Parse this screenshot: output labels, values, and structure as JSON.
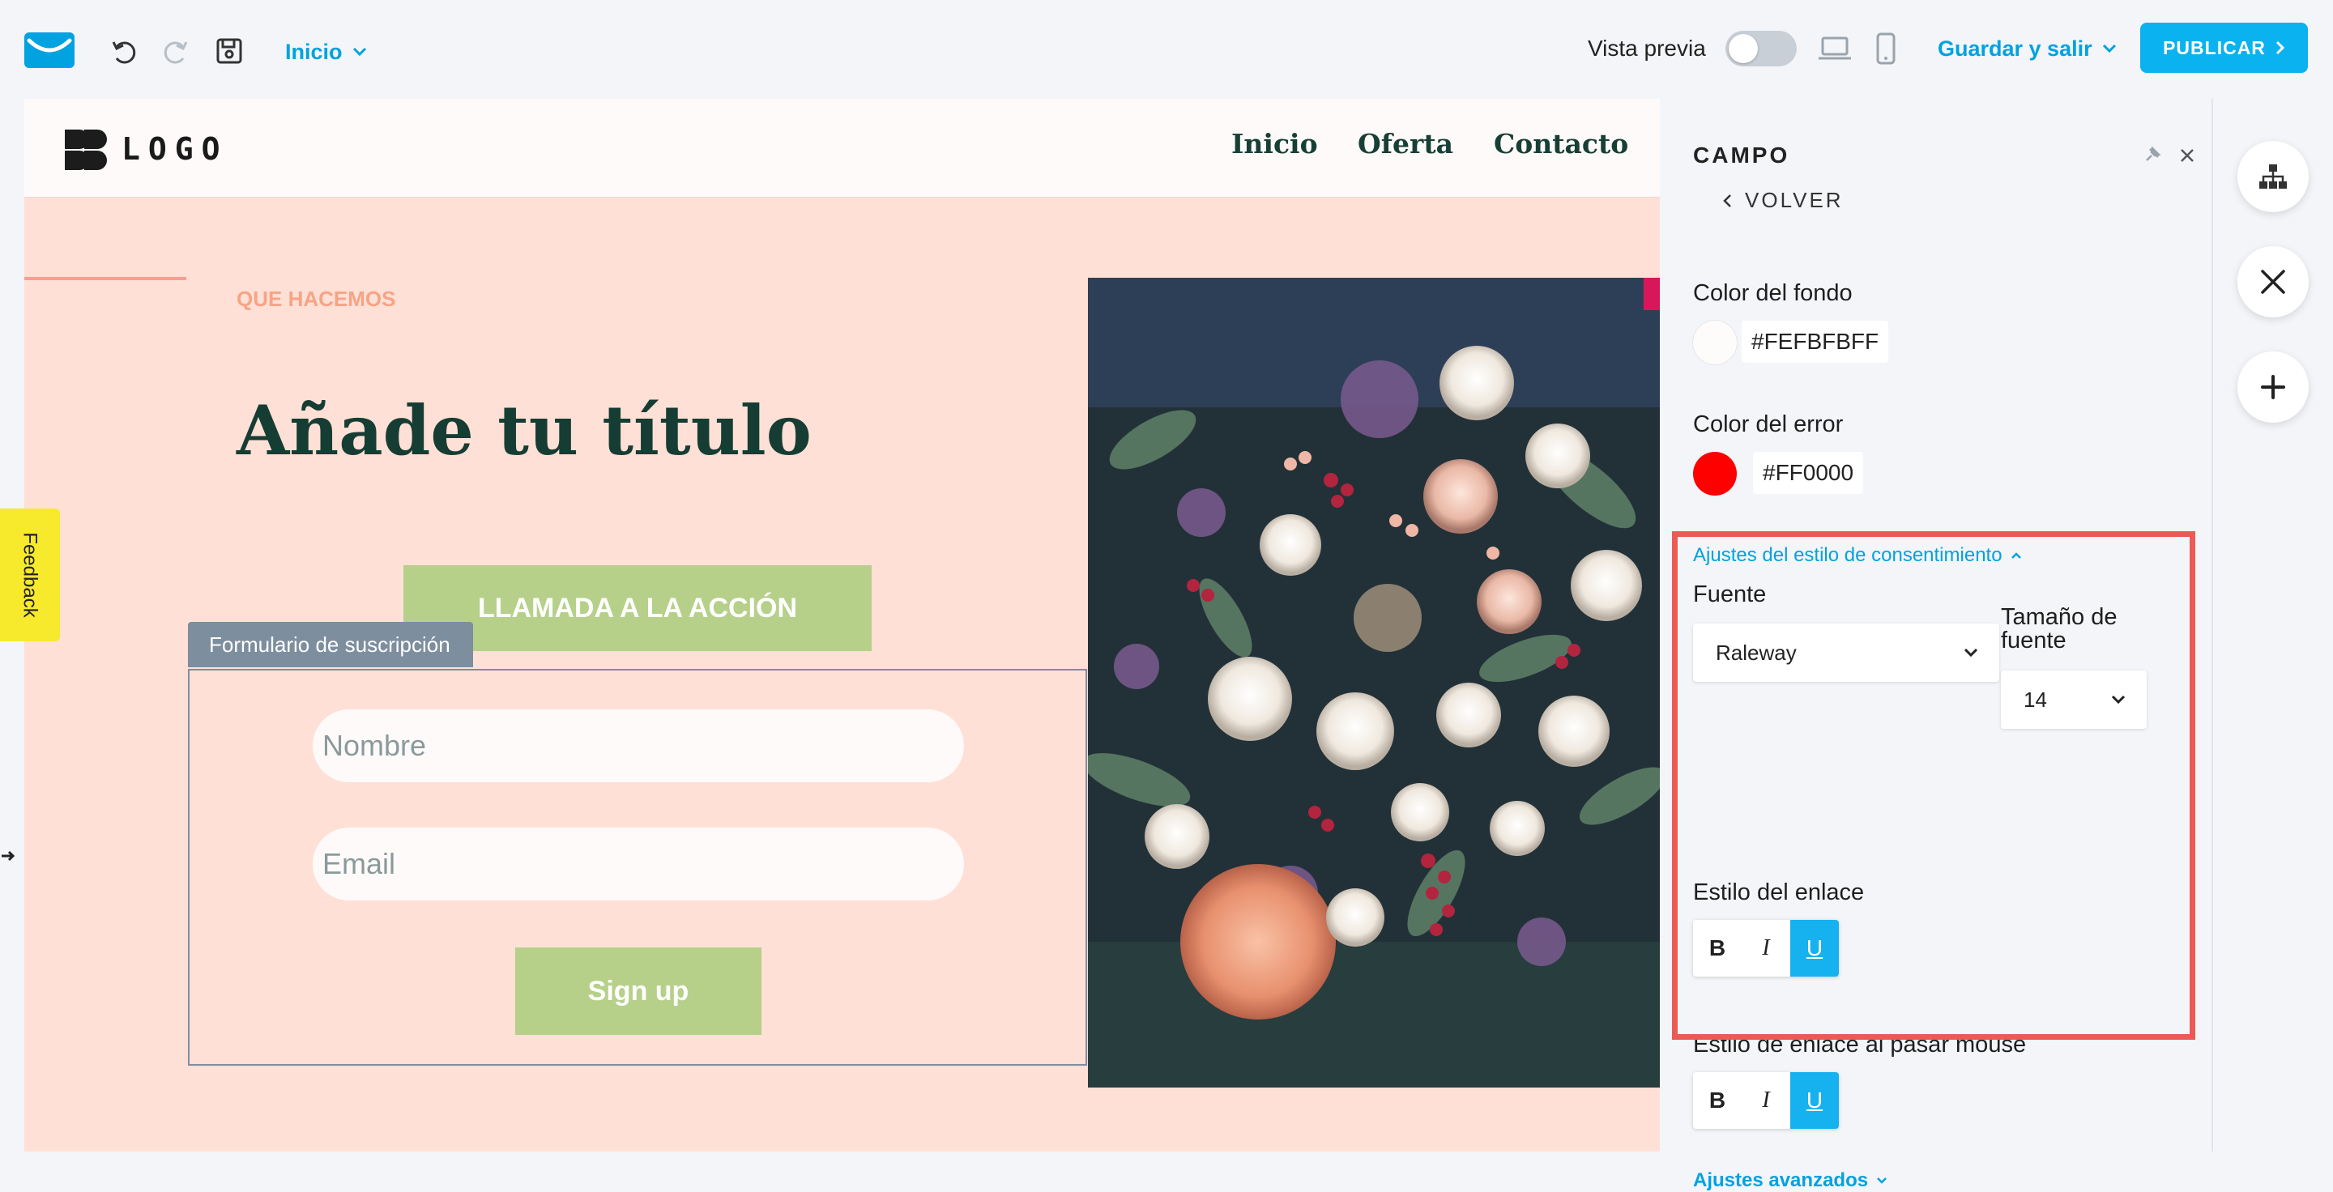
{
  "toolbar": {
    "page_select": "Inicio",
    "vista_previa": "Vista previa",
    "guardar": "Guardar y salir",
    "publicar": "PUBLICAR"
  },
  "site": {
    "logo_text": "LOGO",
    "nav": [
      "Inicio",
      "Oferta",
      "Contacto"
    ],
    "kicker": "QUE HACEMOS",
    "title": "Añade tu título",
    "cta": "LLAMADA A LA ACCIÓN",
    "form_tag": "Formulario de suscripción",
    "name_placeholder": "Nombre",
    "email_placeholder": "Email",
    "signup": "Sign up"
  },
  "feedback": "Feedback",
  "panel": {
    "title": "CAMPO",
    "back": "VOLVER",
    "bg_label": "Color del fondo",
    "bg_hex": "#FEFBFBFF",
    "bg_color": "#FEFBFB",
    "error_label": "Color del error",
    "error_hex": "#FF0000",
    "error_color": "#FF0000",
    "consent_toggle": "Ajustes del estilo de consentimiento",
    "font_label": "Fuente",
    "font_value": "Raleway",
    "size_label": "Tamaño de fuente",
    "size_value": "14",
    "link_style_label": "Estilo del enlace",
    "hover_style_label": "Estilo de enlace al pasar mouse",
    "style_buttons": [
      "B",
      "I",
      "U"
    ],
    "advanced": "Ajustes avanzados"
  },
  "colors": {
    "accent": "#00A2E0",
    "publish": "#0AB2EF",
    "highlight_frame": "#EC5A55",
    "canvas_bg": "#FFE0D6",
    "cta_green": "#B6D08A"
  }
}
